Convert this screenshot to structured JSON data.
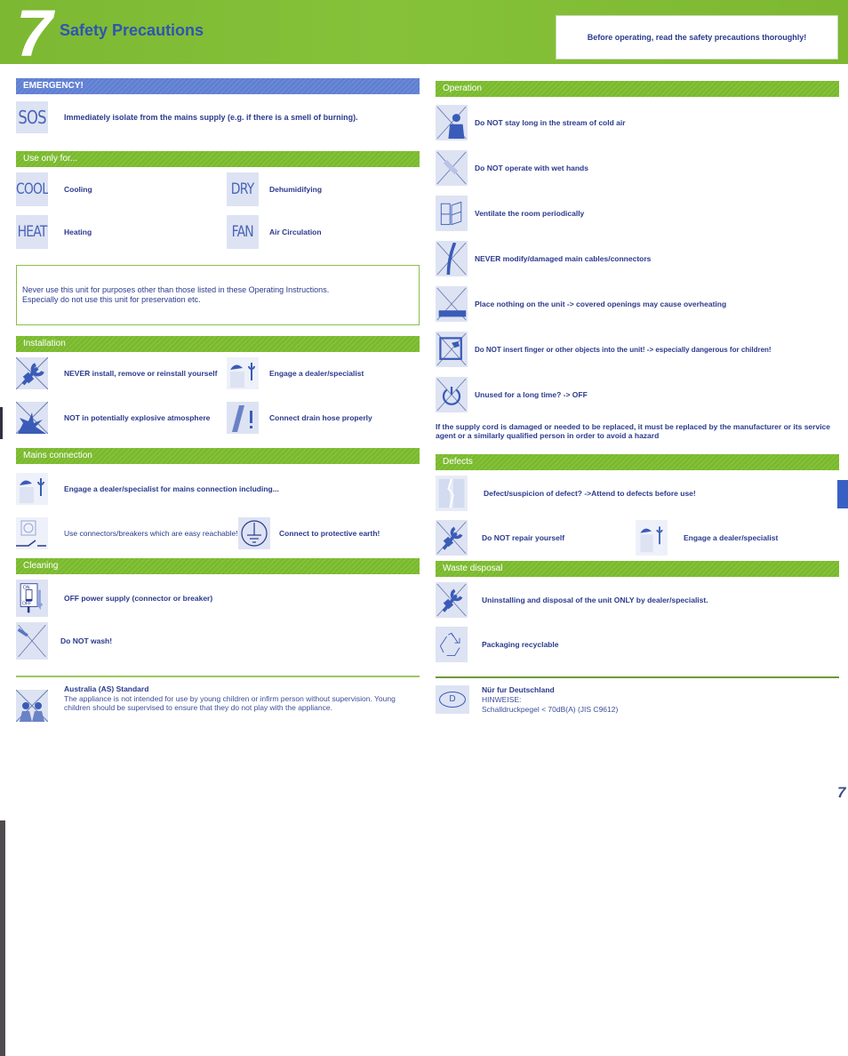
{
  "header": {
    "chapter_number": "7",
    "title": "Safety Precautions",
    "notice": "Before operating, read the safety precautions thoroughly!"
  },
  "left": {
    "emergency": {
      "heading": "EMERGENCY!",
      "icon_text": "SOS",
      "text": "Immediately isolate from the mains supply (e.g. if there is a smell of burning)."
    },
    "use_only": {
      "heading": "Use only for...",
      "items": [
        {
          "icon_text": "COOL",
          "label": "Cooling"
        },
        {
          "icon_text": "DRY",
          "label": "Dehumidifying"
        },
        {
          "icon_text": "HEAT",
          "label": "Heating"
        },
        {
          "icon_text": "FAN",
          "label": "Air Circulation"
        }
      ],
      "warning_line1": "Never use this unit for purposes other than those listed in these Operating Instructions.",
      "warning_line2": "Especially do not use this unit for preservation etc."
    },
    "installation": {
      "heading": "Installation",
      "items": [
        {
          "icon": "no-tools-icon",
          "label": "NEVER install, remove or reinstall yourself"
        },
        {
          "icon": "specialist-icon",
          "label": "Engage a dealer/specialist"
        },
        {
          "icon": "no-explosion-icon",
          "label": "NOT in potentially explosive atmosphere"
        },
        {
          "icon": "drain-hose-icon",
          "label": "Connect drain hose properly"
        }
      ]
    },
    "mains": {
      "heading": "Mains connection",
      "items": [
        {
          "icon": "specialist-icon",
          "label": "Engage a dealer/specialist for mains connection including..."
        },
        {
          "icon": "breaker-icon",
          "label": "Use connectors/breakers which are easy reachable!"
        },
        {
          "icon": "earth-icon",
          "label": "Connect to protective earth!"
        }
      ]
    },
    "cleaning": {
      "heading": "Cleaning",
      "items": [
        {
          "icon": "power-off-switch-icon",
          "label": "OFF power supply (connector or breaker)",
          "switch_on": "ON",
          "switch_off": "OFF"
        },
        {
          "icon": "no-wash-icon",
          "label": "Do NOT wash!"
        }
      ]
    },
    "australia": {
      "icon": "no-children-icon",
      "title": "Australia (AS) Standard",
      "text": "The appliance is not intended for use by young children or infirm person without supervision. Young children should be supervised to ensure that they do not play with the appliance."
    }
  },
  "right": {
    "operation": {
      "heading": "Operation",
      "items": [
        {
          "icon": "no-cold-air-icon",
          "label": "Do NOT stay long in the stream of cold air"
        },
        {
          "icon": "no-wet-hands-icon",
          "label": "Do NOT operate with wet hands"
        },
        {
          "icon": "ventilate-window-icon",
          "label": "Ventilate the room periodically"
        },
        {
          "icon": "no-cable-modify-icon",
          "label": "NEVER modify/damaged main cables/connectors"
        },
        {
          "icon": "no-cover-icon",
          "label": "Place nothing on the unit -> covered openings may cause overheating"
        },
        {
          "icon": "no-finger-icon",
          "label": "Do NOT insert finger or other objects into the unit! -> especially dangerous for children!"
        },
        {
          "icon": "power-icon",
          "label": "Unused for a long time? -> OFF"
        }
      ],
      "cord_note": "If the supply cord is damaged or needed to be replaced, it must be replaced by the manufacturer or its service agent or a similarly qualified person in order to avoid a hazard"
    },
    "defects": {
      "heading": "Defects",
      "items": [
        {
          "icon": "defect-icon",
          "label": "Defect/suspicion of defect? ->Attend to defects before use!"
        },
        {
          "icon": "no-repair-icon",
          "label": "Do NOT repair yourself"
        },
        {
          "icon": "specialist-icon",
          "label": "Engage a dealer/specialist"
        }
      ]
    },
    "waste": {
      "heading": "Waste disposal",
      "items": [
        {
          "icon": "no-tools-icon",
          "label": "Uninstalling and disposal of the unit ONLY by dealer/specialist."
        },
        {
          "icon": "recycle-icon",
          "label": "Packaging recyclable"
        }
      ]
    },
    "germany": {
      "icon_text": "D",
      "title": "Nür fur Deutschland",
      "line1": "HINWEISE:",
      "line2": "Schalldruckpegel < 70dB(A) (JIS C9612)"
    }
  },
  "page_number": "7",
  "colors": {
    "green_bar": "#7cb832",
    "blue_bar": "#5f7ed0",
    "text_navy": "#2b3a8c",
    "icon_bg": "#dde3f3",
    "icon_blue": "#3a5cb8",
    "side_tab": "#3860c4"
  }
}
